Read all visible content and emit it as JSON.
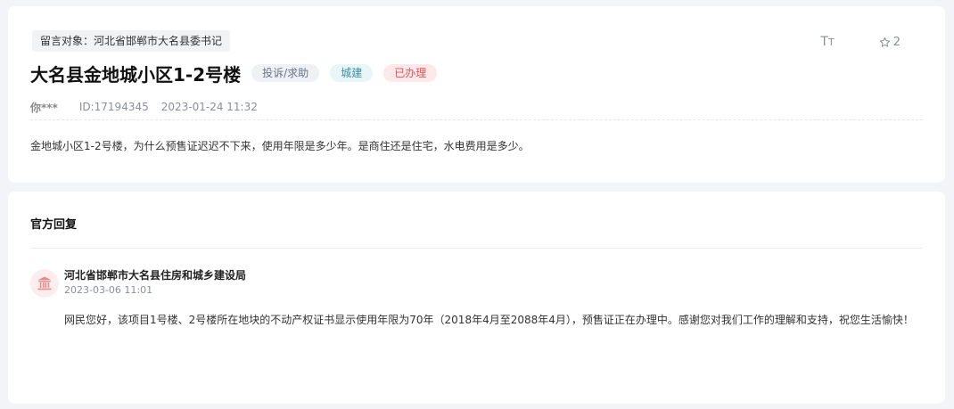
{
  "message": {
    "recipient": "留言对象：河北省邯郸市大名县委书记",
    "title": "大名县金地城小区1-2号楼",
    "tags": {
      "type": "投诉/求助",
      "domain": "城建",
      "status": "已办理"
    },
    "author": "你***",
    "id": "ID:17194345",
    "time": "2023-01-24 11:32",
    "content": "金地城小区1-2号楼，为什么预售证迟迟不下来，使用年限是多少年。是商住还是住宅，水电费用是多少。"
  },
  "tools": {
    "font_size_big": "T",
    "font_size_small": "T",
    "favorite_count": "2"
  },
  "reply": {
    "heading": "官方回复",
    "org": "河北省邯郸市大名县住房和城乡建设局",
    "time": "2023-03-06 11:01",
    "body": "网民您好，该项目1号楼、2号楼所在地块的不动产权证书显示使用年限为70年（2018年4月至2088年4月），预售证正在办理中。感谢您对我们工作的理解和支持，祝您生活愉快！"
  },
  "colors": {
    "status_red": "#e2525a",
    "domain_teal": "#3d8fa0",
    "background": "#f3f4f7"
  },
  "icons": {
    "font_size": "font-size-icon",
    "favorite": "star-icon",
    "avatar": "government-building-icon"
  }
}
